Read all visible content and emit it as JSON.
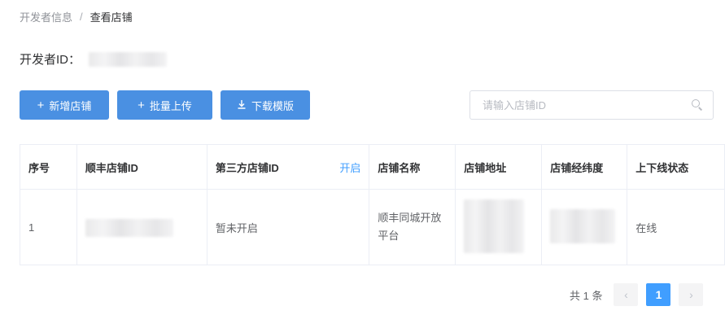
{
  "breadcrumb": {
    "parent": "开发者信息",
    "separator": "/",
    "current": "查看店铺"
  },
  "developer": {
    "label": "开发者ID："
  },
  "toolbar": {
    "add_store": {
      "icon": "plus-icon",
      "label": "新增店铺"
    },
    "batch_upload": {
      "icon": "plus-icon",
      "label": "批量上传"
    },
    "download_template": {
      "icon": "download-icon",
      "label": "下载模版"
    }
  },
  "search": {
    "placeholder": "请输入店铺ID",
    "icon": "search-icon"
  },
  "table": {
    "headers": [
      "序号",
      "顺丰店铺ID",
      "第三方店铺ID",
      "店铺名称",
      "店铺地址",
      "店铺经纬度",
      "上下线状态"
    ],
    "header_action": "开启",
    "rows": [
      {
        "seq": "1",
        "third_party_id": "暂未开启",
        "name": "顺丰同城开放平台",
        "status": "在线"
      }
    ]
  },
  "pagination": {
    "total_text": "共 1 条",
    "current_page": "1",
    "prev_icon": "chevron-left-icon",
    "next_icon": "chevron-right-icon"
  },
  "colors": {
    "primary": "#4a90e2",
    "link": "#409eff",
    "border": "#ebeef5"
  }
}
